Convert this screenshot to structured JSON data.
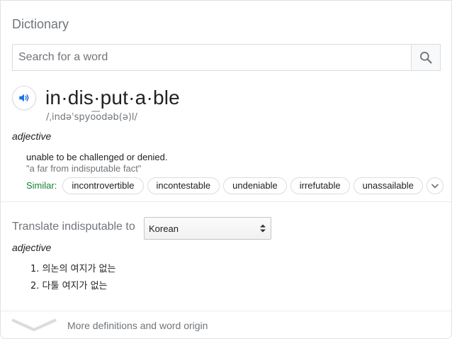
{
  "header": {
    "title": "Dictionary"
  },
  "search": {
    "placeholder": "Search for a word",
    "value": ""
  },
  "entry": {
    "headword": "in·dis·put·a·ble",
    "phonetic": "/ˌindəˈspyo͞odəb(ə)l/",
    "part_of_speech": "adjective",
    "definition": "unable to be challenged or denied.",
    "example": "\"a far from indisputable fact\"",
    "similar_label": "Similar:",
    "similar": [
      "incontrovertible",
      "incontestable",
      "undeniable",
      "irrefutable",
      "unassailable"
    ]
  },
  "translate": {
    "label": "Translate indisputable to",
    "language": "Korean",
    "part_of_speech": "adjective",
    "items": [
      "1. 의논의 여지가 없는",
      "2. 다툴 여지가 없는"
    ]
  },
  "footer": {
    "more_label": "More definitions and word origin"
  },
  "colors": {
    "accent_blue": "#1a73e8",
    "similar_green": "#188038",
    "muted": "#70757a"
  }
}
